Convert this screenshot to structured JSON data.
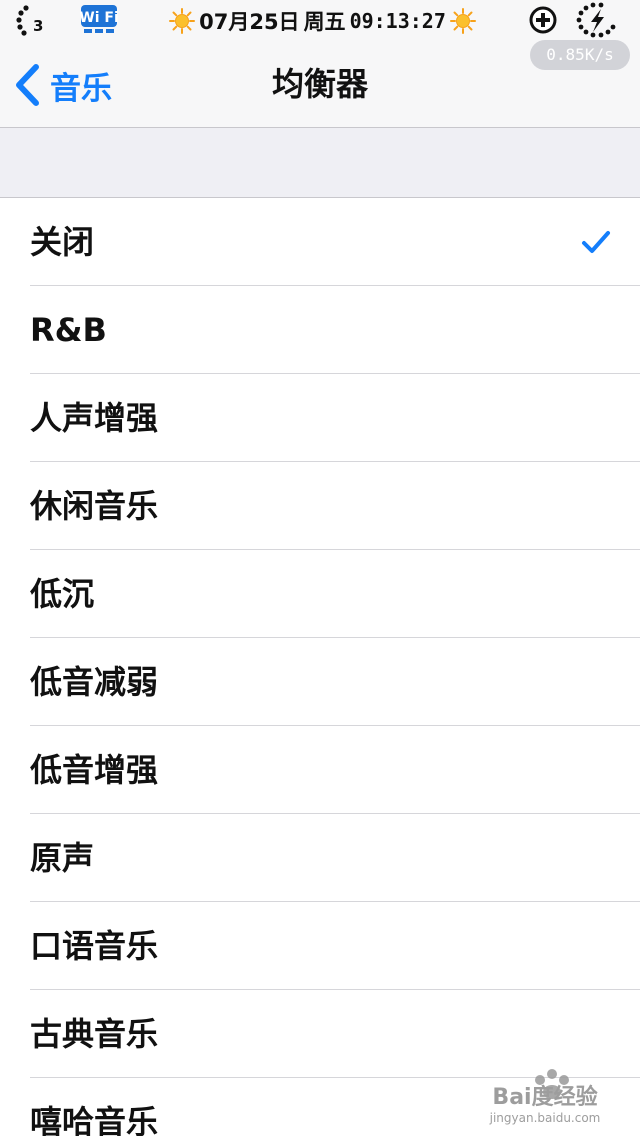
{
  "status_bar": {
    "signal_label": "3",
    "wifi_label": "Wi Fi",
    "date": "07月25日",
    "weekday": "周五",
    "time": "09:13:27",
    "network_speed": "0.85K/s"
  },
  "nav": {
    "back_label": "音乐",
    "title": "均衡器"
  },
  "equalizer": {
    "selected_index": 0,
    "presets": [
      {
        "label": "关闭",
        "selected": true
      },
      {
        "label": "R&B",
        "selected": false
      },
      {
        "label": "人声增强",
        "selected": false
      },
      {
        "label": "休闲音乐",
        "selected": false
      },
      {
        "label": "低沉",
        "selected": false
      },
      {
        "label": "低音减弱",
        "selected": false
      },
      {
        "label": "低音增强",
        "selected": false
      },
      {
        "label": "原声",
        "selected": false
      },
      {
        "label": "口语音乐",
        "selected": false
      },
      {
        "label": "古典音乐",
        "selected": false
      },
      {
        "label": "嘻哈音乐",
        "selected": false
      }
    ]
  },
  "watermark": {
    "brand": "Bai度经验",
    "url": "jingyan.baidu.com"
  },
  "colors": {
    "accent": "#147efb",
    "nav_background": "#f7f7f8",
    "group_gap": "#efeff4",
    "separator": "#d6d6da",
    "speed_pill": "#d2d3d8",
    "sun": "#f7a21b"
  },
  "icons": {
    "signal": "signal-dots-icon",
    "wifi": "wifi-badge-icon",
    "weather": "sun-icon",
    "plus": "circle-plus-icon",
    "battery": "charging-ring-icon",
    "back": "chevron-left-icon",
    "selected": "checkmark-icon"
  }
}
